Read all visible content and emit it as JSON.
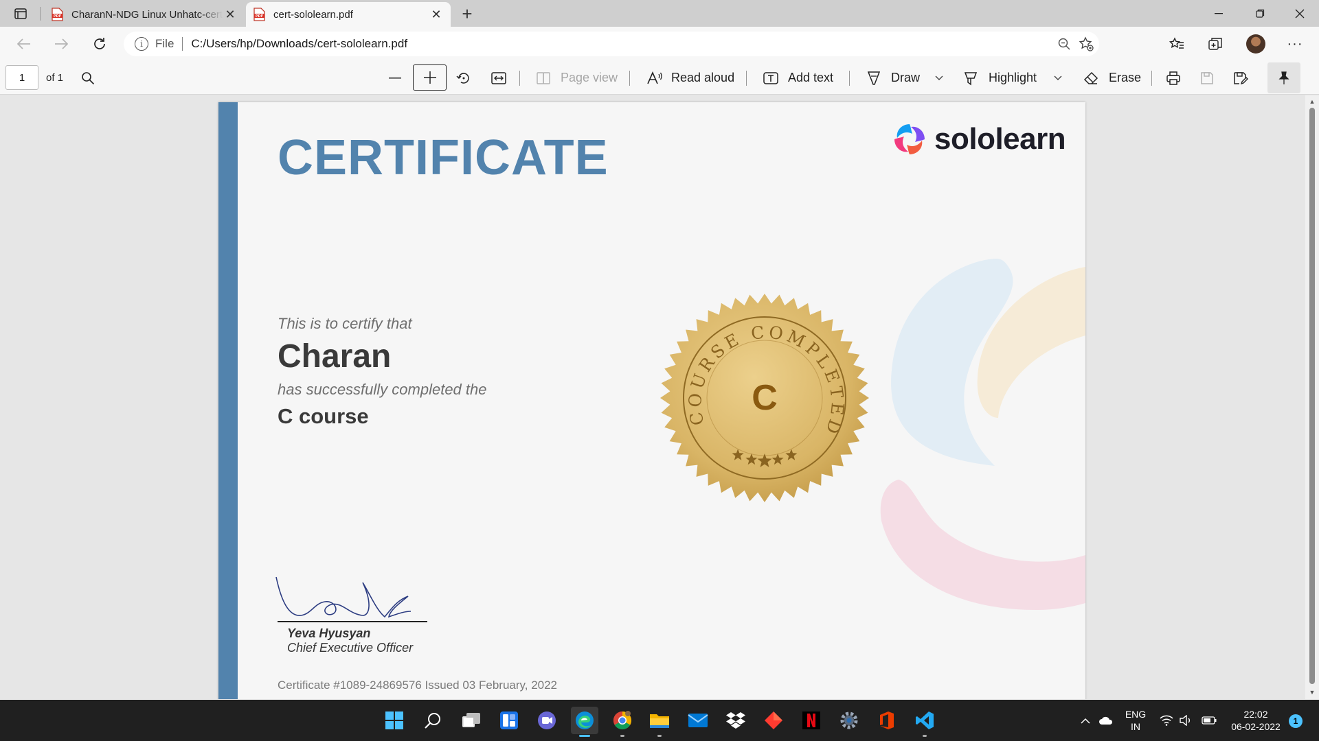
{
  "browser": {
    "tabs": [
      {
        "title": "CharanN-NDG Linux Unhatc-cert",
        "active": false
      },
      {
        "title": "cert-sololearn.pdf",
        "active": true
      }
    ],
    "address": {
      "scheme": "File",
      "url": "C:/Users/hp/Downloads/cert-sololearn.pdf"
    }
  },
  "pdf_toolbar": {
    "page_number": "1",
    "page_count": "of 1",
    "page_view": "Page view",
    "read_aloud": "Read aloud",
    "add_text": "Add text",
    "draw": "Draw",
    "highlight": "Highlight",
    "erase": "Erase"
  },
  "certificate": {
    "title": "CERTIFICATE",
    "brand": "sololearn",
    "lead": "This is to certify that",
    "recipient": "Charan",
    "completed_text": "has successfully completed the",
    "course": "C course",
    "seal": {
      "arc_text": "COURSE COMPLETED",
      "letter": "C"
    },
    "signer_name": "Yeva Hyusyan",
    "signer_role": "Chief Executive Officer",
    "certificate_id": "Certificate #1089-24869576 Issued 03 February, 2022"
  },
  "taskbar": {
    "language": "ENG",
    "region": "IN",
    "time": "22:02",
    "date": "06-02-2022",
    "notifications": "1"
  },
  "colors": {
    "accent_blue": "#5283ad",
    "seal_gold": "#d9b566",
    "tab_strip": "#cfcfcf",
    "taskbar": "#202020"
  }
}
